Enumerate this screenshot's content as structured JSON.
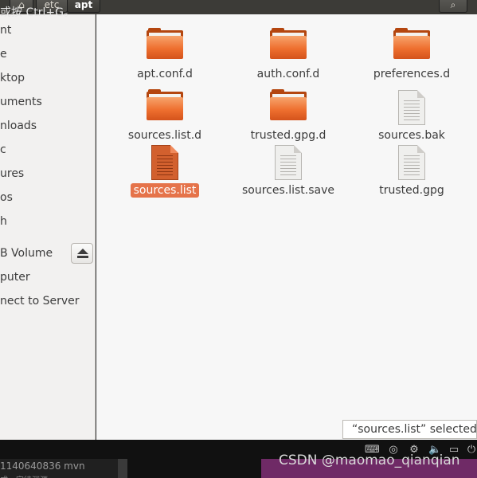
{
  "header": {
    "path": [
      "etc",
      "apt"
    ],
    "home_icon": "home-icon",
    "search_icon": "search-icon"
  },
  "sidebar": {
    "items": [
      {
        "label": "nt"
      },
      {
        "label": "e"
      },
      {
        "label": "ktop"
      },
      {
        "label": "uments"
      },
      {
        "label": "nloads"
      },
      {
        "label": "c"
      },
      {
        "label": "ures"
      },
      {
        "label": "os"
      },
      {
        "label": "h"
      },
      {
        "label": "B Volume"
      },
      {
        "label": "puter"
      },
      {
        "label": "nect to Server"
      }
    ],
    "eject_icon": "eject-icon"
  },
  "files": [
    {
      "name": "apt.conf.d",
      "type": "folder"
    },
    {
      "name": "auth.conf.d",
      "type": "folder"
    },
    {
      "name": "preferences.d",
      "type": "folder"
    },
    {
      "name": "sources.list.d",
      "type": "folder"
    },
    {
      "name": "trusted.gpg.d",
      "type": "folder"
    },
    {
      "name": "sources.bak",
      "type": "document"
    },
    {
      "name": "sources.list",
      "type": "document",
      "selected": true
    },
    {
      "name": "sources.list.save",
      "type": "document"
    },
    {
      "name": "trusted.gpg",
      "type": "document"
    }
  ],
  "status": {
    "text": "“sources.list” selected"
  },
  "bottom": {
    "hint": "或按 Ctrl+G。",
    "terminal_line": "1140640836 mvn",
    "terminal_line2": "成，定待深源",
    "watermark": "CSDN @maomao_qianqian"
  },
  "colors": {
    "selection": "#e5734a",
    "folder": "#ee6f2f",
    "header": "#3c3b37",
    "sidebar": "#f2f1f0",
    "main": "#f7f7f7"
  }
}
